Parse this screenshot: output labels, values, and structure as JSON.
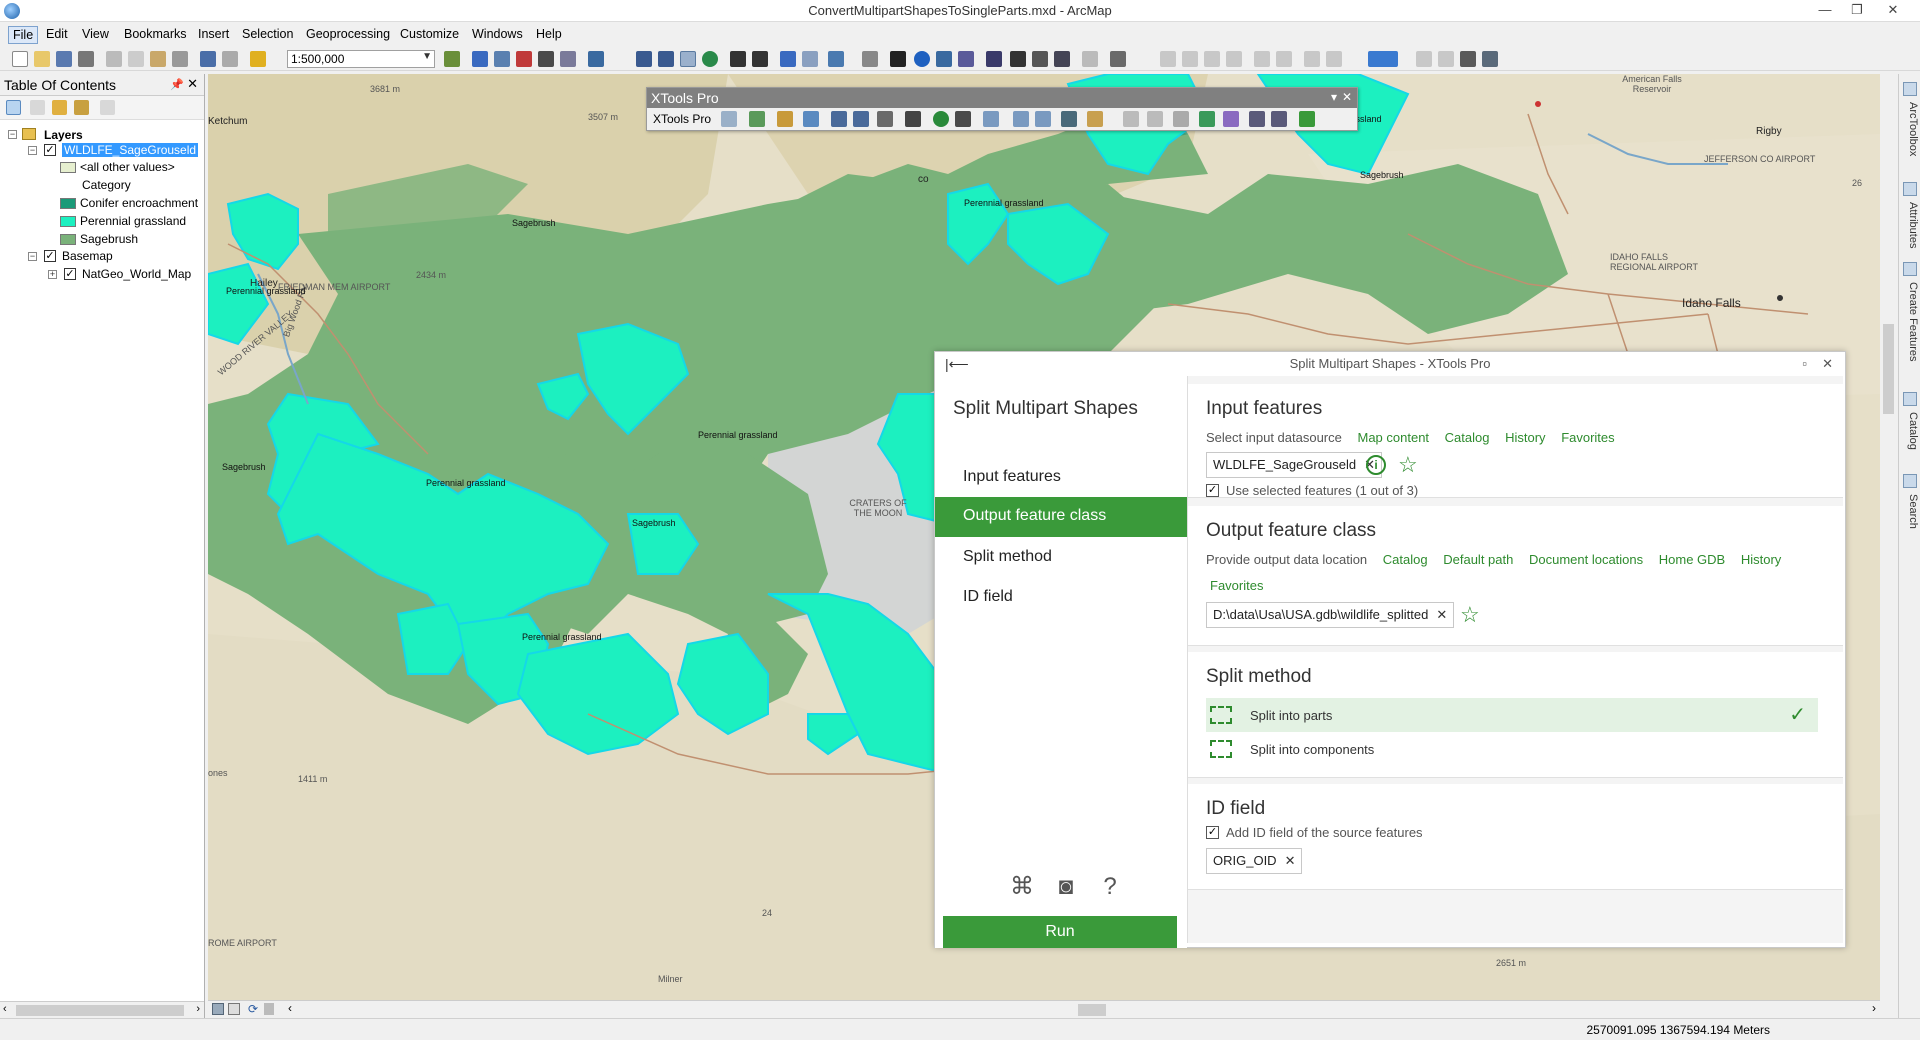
{
  "window": {
    "title": "ConvertMultipartShapesToSingleParts.mxd - ArcMap"
  },
  "menu": [
    "File",
    "Edit",
    "View",
    "Bookmarks",
    "Insert",
    "Selection",
    "Geoprocessing",
    "Customize",
    "Windows",
    "Help"
  ],
  "toolbar": {
    "scale": "1:500,000"
  },
  "toc": {
    "title": "Table Of Contents",
    "root": "Layers",
    "layer1": "WLDLFE_SageGrouseld",
    "values": [
      "<all other values>",
      "Category",
      "Conifer encroachment",
      "Perennial grassland",
      "Sagebrush"
    ],
    "basemap_group": "Basemap",
    "basemap_layer": "NatGeo_World_Map"
  },
  "colors": {
    "conifer": "#1a9a78",
    "grassland": "#1cf0c0",
    "sagebrush": "#7ab27a",
    "accent": "#3a9a3a"
  },
  "map_labels": {
    "ketchum": "Ketchum",
    "hailey": "Hailey",
    "idaho_falls": "Idaho Falls",
    "rigby": "Rigby",
    "american_falls_reservoir": "American Falls Reservoir",
    "craters": "CRATERS OF THE MOON",
    "wood_river_valley": "WOOD RIVER VALLEY",
    "big_wood_river": "Big Wood Riv",
    "friedman": "FRIEDMAN MEM AIRPORT",
    "jefferson": "JEFFERSON CO AIRPORT",
    "idaho_falls_airport": "IDAHO FALLS REGIONAL AIRPORT",
    "elev1": "3681 m",
    "elev2": "3507 m",
    "elev3": "2434 m",
    "elev4": "1411 m",
    "elev5": "2651 m",
    "road24": "24",
    "road26": "26",
    "pg1": "Perennial grassland",
    "pg2": "Perennial grassland",
    "pg3": "Perennial grassland",
    "pg4": "Perennial grassland",
    "pg5": "Perennial grassland",
    "pg6": "Perennial grassland",
    "sb1": "Sagebrush",
    "sb2": "Sagebrush",
    "sb3": "Sagebrush",
    "sb4": "Sagebrush",
    "rome_airport": "ROME AIRPORT",
    "ones": "ones",
    "co": "co",
    "milner": "Milner"
  },
  "xtools_toolbar": {
    "title": "XTools Pro",
    "label": "XTools Pro"
  },
  "dialog": {
    "title": "Split Multipart Shapes - XTools Pro",
    "heading": "Split Multipart Shapes",
    "nav": [
      "Input features",
      "Output feature class",
      "Split method",
      "ID field"
    ],
    "active_nav_index": 1,
    "run_label": "Run",
    "input": {
      "title": "Input features",
      "prompt": "Select input datasource",
      "links": [
        "Map content",
        "Catalog",
        "History",
        "Favorites"
      ],
      "value": "WLDLFE_SageGrouseld",
      "use_selected": "Use selected features (1 out of 3)",
      "use_selected_checked": true
    },
    "output": {
      "title": "Output feature class",
      "prompt": "Provide output data location",
      "links": [
        "Catalog",
        "Default path",
        "Document locations",
        "Home GDB",
        "History"
      ],
      "links2": [
        "Favorites"
      ],
      "value": "D:\\data\\Usa\\USA.gdb\\wildlife_splitted"
    },
    "method": {
      "title": "Split method",
      "options": [
        "Split into parts",
        "Split into components"
      ],
      "selected_index": 0
    },
    "idfield": {
      "title": "ID field",
      "add_label": "Add ID field of the source features",
      "add_checked": true,
      "value": "ORIG_OID"
    }
  },
  "dock_tabs": [
    "ArcToolbox",
    "Attributes",
    "Create Features",
    "Catalog",
    "Search"
  ],
  "status": {
    "coords": "2570091.095  1367594.194 Meters"
  }
}
